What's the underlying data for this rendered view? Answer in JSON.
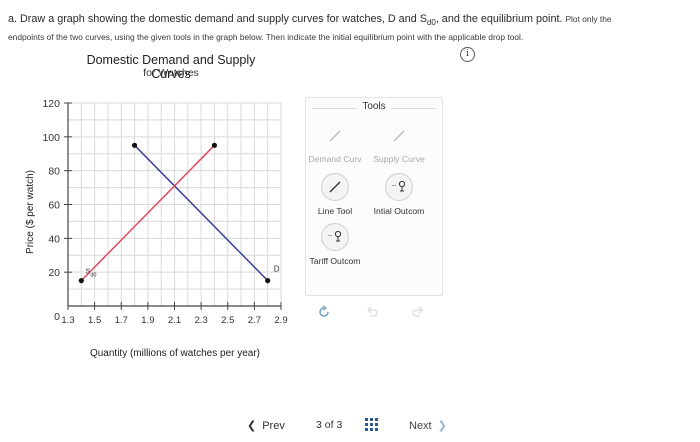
{
  "question": {
    "line1_prefix": "a. Draw a graph showing the domestic demand and supply curves for watches, D and S",
    "line1_sub": "d0",
    "line1_suffix": ", and the equilibrium point.",
    "line1_small": "Plot only the",
    "line2": "endpoints of the two curves, using the given tools in the graph below. Then indicate the initial equilibrium point with the applicable drop tool."
  },
  "info_icon": "i",
  "chart_data": {
    "type": "line",
    "title": "Domestic Demand and Supply Curves",
    "subtitle": "for Watches",
    "xlabel": "Quantity (millions of watches per year)",
    "ylabel": "Price ($ per watch)",
    "xlim": [
      1.3,
      2.9
    ],
    "ylim": [
      0,
      120
    ],
    "x_ticks": [
      "1.3",
      "1.5",
      "1.7",
      "1.9",
      "2.1",
      "2.3",
      "2.5",
      "2.7",
      "2.9"
    ],
    "y_ticks": [
      "0",
      "20",
      "40",
      "60",
      "80",
      "100",
      "120"
    ],
    "grid": true,
    "series": [
      {
        "name": "D",
        "label": "D",
        "color": "#3a3f99",
        "points": [
          [
            1.8,
            95
          ],
          [
            2.8,
            15
          ]
        ]
      },
      {
        "name": "Sd0",
        "label": "S",
        "sub": "d0",
        "color": "#e04a5a",
        "points": [
          [
            1.4,
            15
          ],
          [
            2.4,
            95
          ]
        ]
      }
    ]
  },
  "tools": {
    "title": "Tools",
    "items": [
      {
        "label": "Demand Curv",
        "icon": "line-icon"
      },
      {
        "label": "Supply Curve",
        "icon": "line-icon"
      },
      {
        "label": "Line Tool",
        "icon": "line-icon"
      },
      {
        "label": "Intial Outcom",
        "icon": "drop-point-icon"
      },
      {
        "label": "Tariff Outcom",
        "icon": "drop-point-icon"
      }
    ]
  },
  "nav": {
    "prev_label": "Prev",
    "page_current": "3",
    "page_of": "of",
    "page_total": "3",
    "next_label": "Next"
  }
}
